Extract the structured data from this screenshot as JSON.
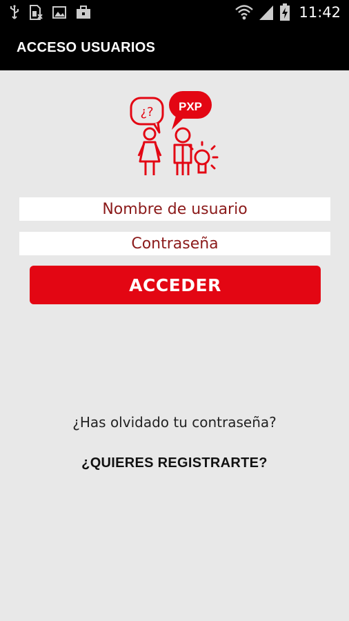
{
  "status_bar": {
    "time": "11:42",
    "icons": [
      "usb-icon",
      "sim-error-icon",
      "image-icon",
      "briefcase-icon",
      "wifi-icon",
      "signal-icon",
      "battery-charging-icon"
    ]
  },
  "app_bar": {
    "title": "ACCESO USUARIOS"
  },
  "logo": {
    "bubble_left_text": "¿?",
    "bubble_right_text": "PXP"
  },
  "form": {
    "username_placeholder": "Nombre de usuario",
    "password_placeholder": "Contraseña",
    "submit_label": "ACCEDER"
  },
  "links": {
    "forgot_password": "¿Has olvidado tu contraseña?",
    "register": "¿QUIERES REGISTRARTE?"
  },
  "colors": {
    "accent": "#e30613",
    "background": "#e8e8e8",
    "bar": "#000000",
    "field_text": "#8b1a1a"
  }
}
